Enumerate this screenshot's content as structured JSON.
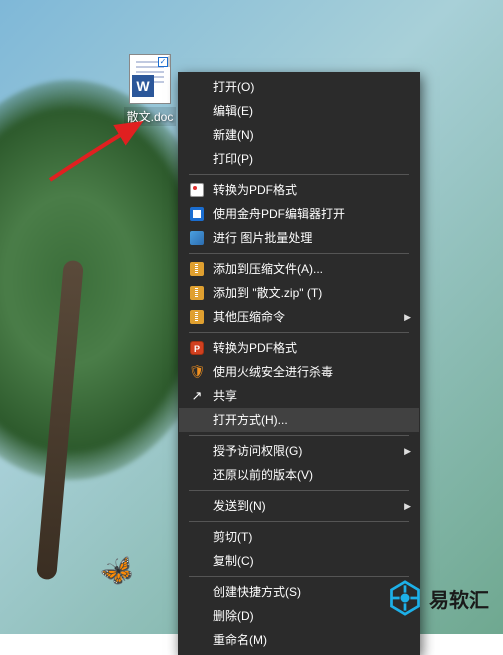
{
  "desktop": {
    "file_label": "散文.doc"
  },
  "menu": {
    "items": [
      {
        "group": 0,
        "label": "打开(O)"
      },
      {
        "group": 0,
        "label": "编辑(E)"
      },
      {
        "group": 0,
        "label": "新建(N)"
      },
      {
        "group": 0,
        "label": "打印(P)"
      },
      {
        "group": 1,
        "label": "转换为PDF格式",
        "icon": "pdf-icon"
      },
      {
        "group": 1,
        "label": "使用金舟PDF编辑器打开",
        "icon": "pdf-editor-icon"
      },
      {
        "group": 1,
        "label": "进行 图片批量处理",
        "icon": "image-batch-icon"
      },
      {
        "group": 2,
        "label": "添加到压缩文件(A)...",
        "icon": "zip-icon"
      },
      {
        "group": 2,
        "label": "添加到 \"散文.zip\" (T)",
        "icon": "zip-icon"
      },
      {
        "group": 2,
        "label": "其他压缩命令",
        "icon": "zip-icon",
        "submenu": true
      },
      {
        "group": 3,
        "label": "转换为PDF格式",
        "icon": "powerpoint-icon"
      },
      {
        "group": 3,
        "label": "使用火绒安全进行杀毒",
        "icon": "shield-icon"
      },
      {
        "group": 3,
        "label": "共享",
        "icon": "share-icon"
      },
      {
        "group": 3,
        "label": "打开方式(H)...",
        "highlight": true
      },
      {
        "group": 4,
        "label": "授予访问权限(G)",
        "submenu": true
      },
      {
        "group": 4,
        "label": "还原以前的版本(V)"
      },
      {
        "group": 5,
        "label": "发送到(N)",
        "submenu": true
      },
      {
        "group": 6,
        "label": "剪切(T)"
      },
      {
        "group": 6,
        "label": "复制(C)"
      },
      {
        "group": 7,
        "label": "创建快捷方式(S)"
      },
      {
        "group": 7,
        "label": "删除(D)"
      },
      {
        "group": 7,
        "label": "重命名(M)"
      }
    ]
  },
  "watermark": {
    "text": "易软汇"
  }
}
